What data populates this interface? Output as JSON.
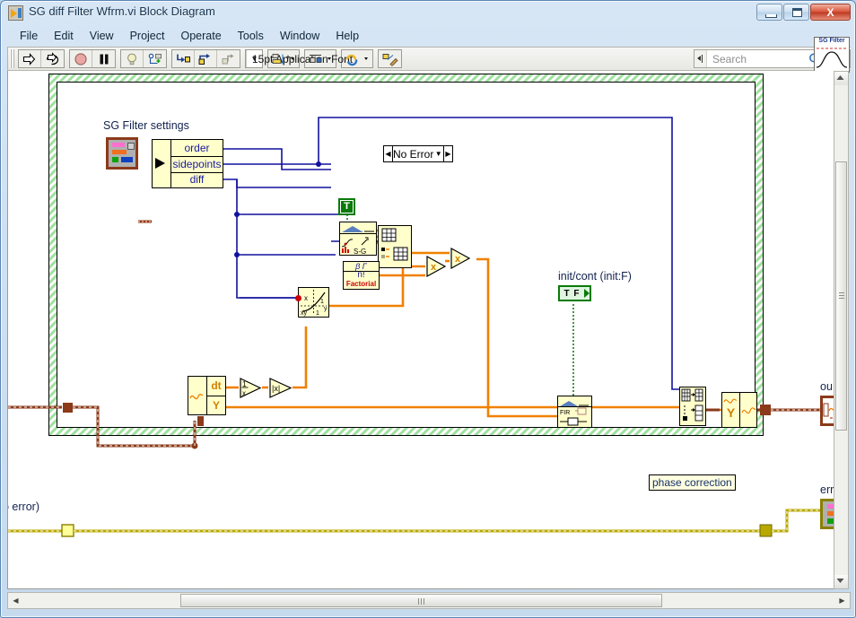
{
  "window": {
    "title": "SG diff Filter Wfrm.vi Block Diagram",
    "app_icon": "labview-vi-icon",
    "controls": {
      "minimize": "minimize-button",
      "maximize": "maximize-button",
      "close": "close-button",
      "close_glyph": "X"
    }
  },
  "menu": {
    "items": [
      "File",
      "Edit",
      "View",
      "Project",
      "Operate",
      "Tools",
      "Window",
      "Help"
    ]
  },
  "toolbar": {
    "buttons": [
      {
        "name": "run-button",
        "icon": "run-arrow-icon",
        "tooltip": "Run"
      },
      {
        "name": "run-continuously-button",
        "icon": "run-continuously-icon",
        "tooltip": "Run Continuously"
      },
      {
        "name": "abort-execution-button",
        "icon": "abort-stop-icon",
        "tooltip": "Abort Execution"
      },
      {
        "name": "pause-button",
        "icon": "pause-icon",
        "tooltip": "Pause"
      },
      {
        "name": "highlight-execution-button",
        "icon": "lightbulb-icon",
        "tooltip": "Highlight Execution"
      },
      {
        "name": "retain-wire-values-button",
        "icon": "retain-values-icon",
        "tooltip": "Retain Wire Values"
      },
      {
        "name": "step-into-button",
        "icon": "step-into-icon",
        "tooltip": "Step Into"
      },
      {
        "name": "step-over-button",
        "icon": "step-over-icon",
        "tooltip": "Step Over"
      },
      {
        "name": "step-out-button",
        "icon": "step-out-icon",
        "tooltip": "Step Out"
      }
    ],
    "font_selector": {
      "value": "15pt Application Font",
      "caret": "▼"
    },
    "align_objects": {
      "name": "align-objects-button",
      "caret": "▼"
    },
    "distribute_objects": {
      "name": "distribute-objects-button",
      "caret": "▼"
    },
    "reorder_objects": {
      "name": "reorder-objects-button",
      "caret": "▼"
    },
    "clean_up_diagram": {
      "name": "clean-up-diagram-button"
    },
    "search": {
      "placeholder": "Search",
      "icon": "magnifier-icon"
    },
    "help": {
      "label": "?",
      "name": "context-help-button"
    }
  },
  "vi_icon": {
    "caption": "SG Filter",
    "glyph": "bell-curve-icon"
  },
  "diagram": {
    "case_structure": {
      "selector_value": "No Error",
      "prev_arrow": "◀",
      "next_arrow": "▶",
      "dropdown_caret": "▼"
    },
    "labels": [
      {
        "name": "sg-filter-settings-label",
        "text": "SG Filter settings"
      },
      {
        "name": "init-cont-label",
        "text": "init/cont (init:F)"
      },
      {
        "name": "phase-correction-label",
        "text": "phase correction"
      },
      {
        "name": "error-in-label",
        "text": "o error)"
      },
      {
        "name": "output-terminal-label",
        "text": "ou"
      },
      {
        "name": "error-out-terminal-label",
        "text": "err"
      }
    ],
    "unbundle": {
      "name": "unbundle-by-name",
      "fields": [
        "order",
        "sidepoints",
        "diff"
      ]
    },
    "constants": [
      {
        "name": "true-boolean-constant",
        "text": "T"
      },
      {
        "name": "false-boolean-constant",
        "text": "T F"
      }
    ],
    "functions": [
      {
        "name": "savitzky-golay-coefficients-node",
        "label": "S-G"
      },
      {
        "name": "factorial-node",
        "label": "Factorial",
        "sub": "n!",
        "top": "β Γ"
      },
      {
        "name": "index-array-node",
        "label": "index-array"
      },
      {
        "name": "power-of-x-node",
        "label": "x^y"
      },
      {
        "name": "multiply-node-1",
        "label": "x"
      },
      {
        "name": "multiply-node-2",
        "label": "x"
      },
      {
        "name": "reciprocal-node",
        "label": "1/x"
      },
      {
        "name": "absolute-value-node",
        "label": "|x|"
      },
      {
        "name": "fir-filter-node",
        "label": "FIR"
      },
      {
        "name": "array-subset-node",
        "label": "array-subset"
      },
      {
        "name": "build-waveform-node",
        "label": "Y"
      },
      {
        "name": "get-waveform-components-node",
        "fields": [
          "dt",
          "Y"
        ]
      }
    ],
    "terminals": [
      {
        "name": "sg-filter-settings-cluster-terminal",
        "type": "cluster"
      },
      {
        "name": "output-waveform-terminal",
        "type": "waveform"
      },
      {
        "name": "error-out-cluster-terminal",
        "type": "error-cluster"
      }
    ]
  },
  "scrollbars": {
    "horizontal": {
      "left_arrow": "◀",
      "right_arrow": "▶"
    },
    "vertical": {
      "up_arrow": "▲",
      "down_arrow": "▼"
    }
  }
}
